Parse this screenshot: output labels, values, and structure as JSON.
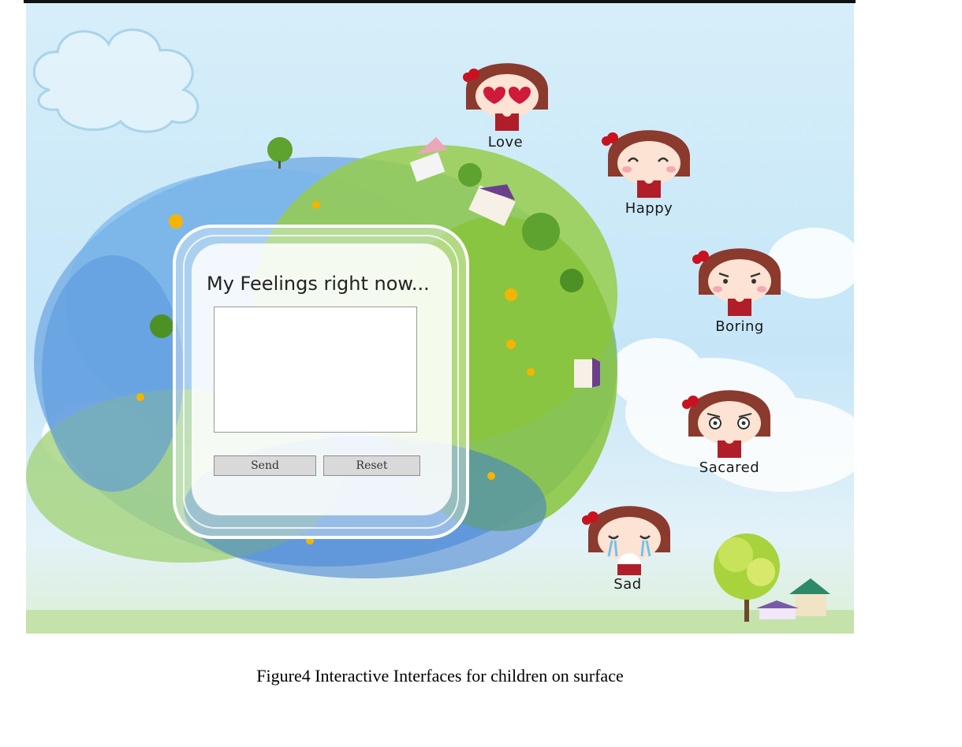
{
  "panel": {
    "title": "My Feelings  right now...",
    "input_value": "",
    "send_label": "Send",
    "reset_label": "Reset"
  },
  "emotions": [
    {
      "label": "Love",
      "icon": "heart-eyes-girl-icon"
    },
    {
      "label": "Happy",
      "icon": "smiling-girl-icon"
    },
    {
      "label": "Boring",
      "icon": "bored-girl-icon"
    },
    {
      "label": "Sacared",
      "icon": "scared-girl-icon"
    },
    {
      "label": "Sad",
      "icon": "crying-girl-icon"
    }
  ],
  "caption": "Figure4 Interactive Interfaces for children on surface",
  "colors": {
    "sky": "#c6e6f8",
    "hair": "#8b3a2e",
    "dress": "#b01e2a",
    "grass": "#8cc63f",
    "water": "#4a8fd6"
  }
}
